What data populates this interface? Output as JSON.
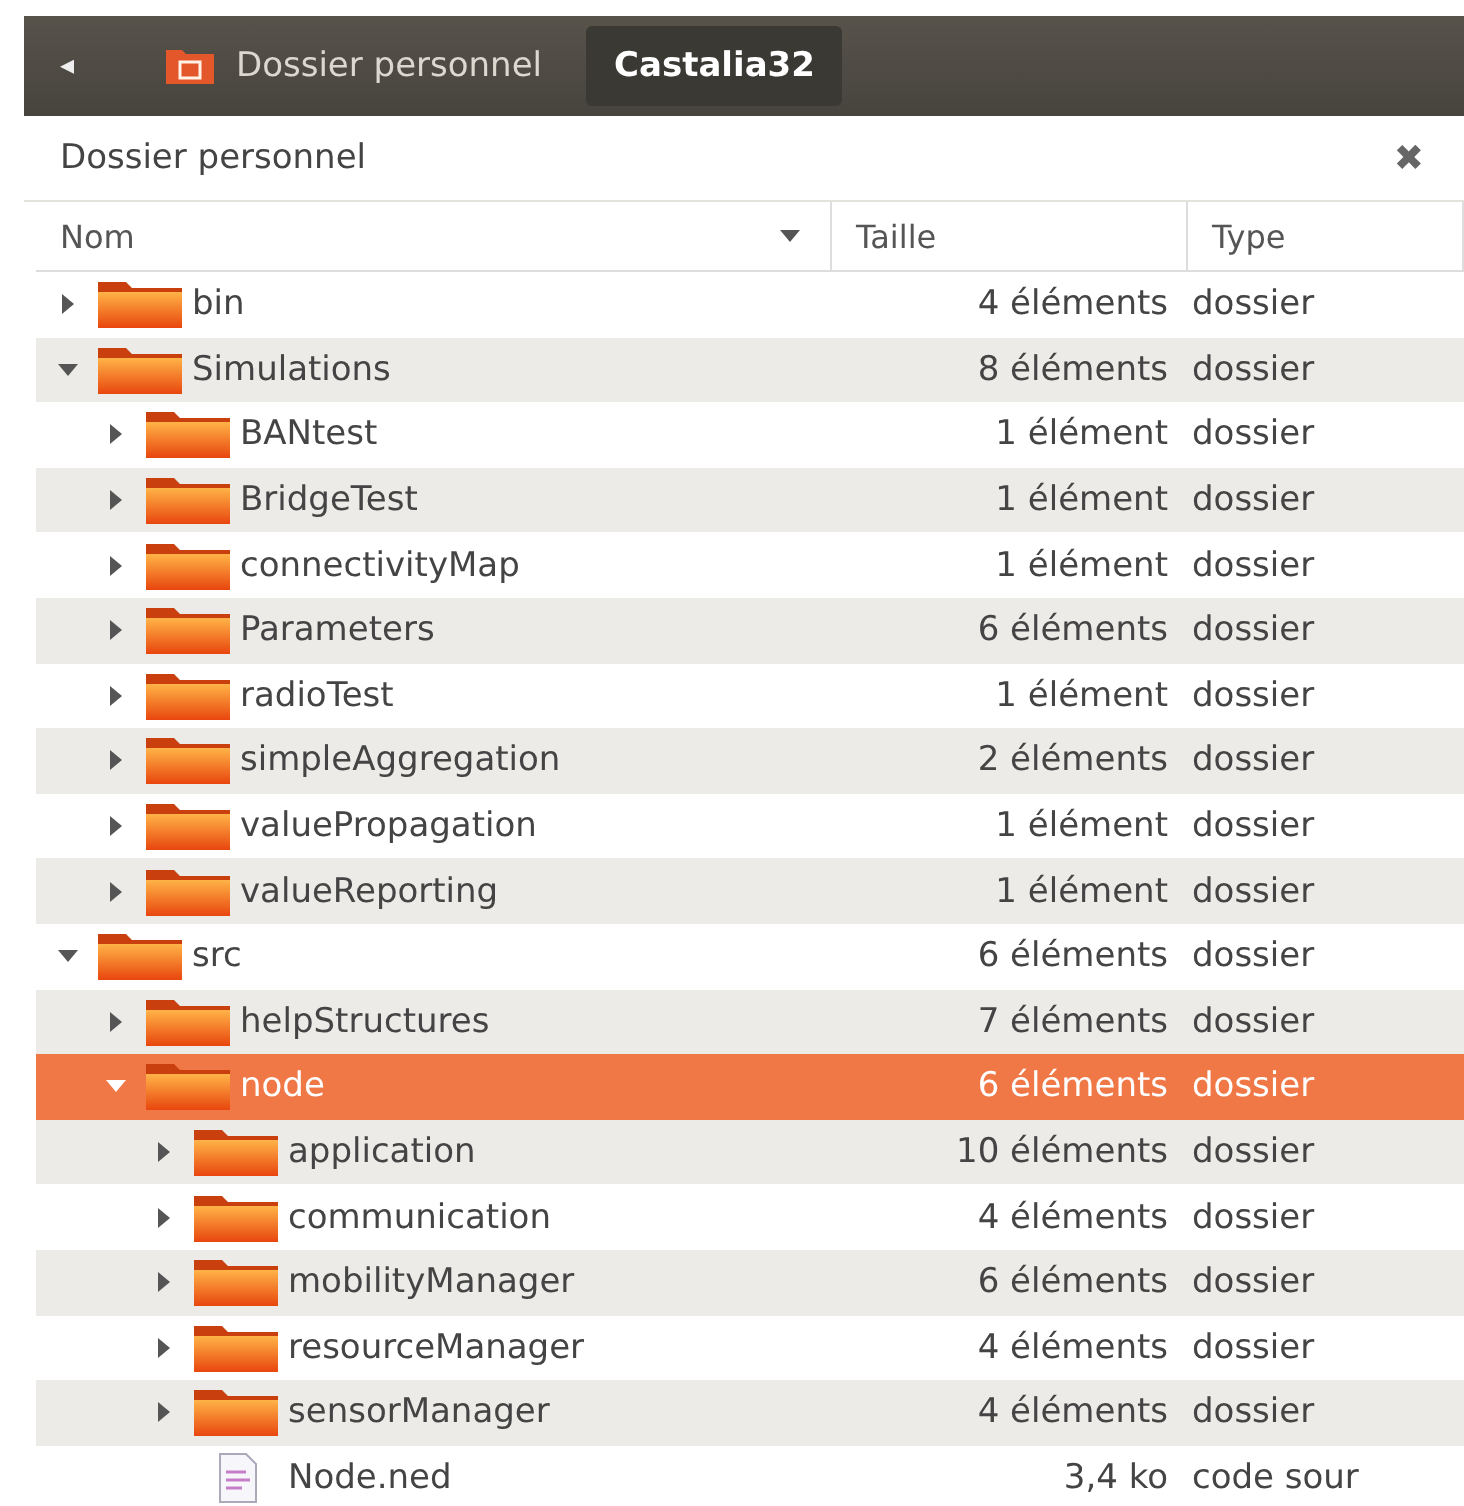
{
  "path_bar": {
    "back": "◂",
    "crumbs": [
      {
        "label": "Dossier personnel",
        "selected": false,
        "kind": "home"
      },
      {
        "label": "Castalia32",
        "selected": true,
        "kind": "plain"
      }
    ]
  },
  "pane": {
    "title": "Dossier personnel",
    "close": "✖"
  },
  "table": {
    "columns": [
      {
        "label": "Nom",
        "sorted": true
      },
      {
        "label": "Taille",
        "sorted": false
      },
      {
        "label": "Type",
        "sorted": false
      }
    ],
    "rows": [
      {
        "kind": "folder",
        "name": "bin",
        "size": "4 éléments",
        "type": "dossier",
        "expanded": false,
        "selected": false
      },
      {
        "kind": "folder",
        "name": "Simulations",
        "size": "8 éléments",
        "type": "dossier",
        "expanded": true,
        "selected": false,
        "children": [
          {
            "kind": "folder",
            "name": "BANtest",
            "size": "1 élément",
            "type": "dossier",
            "expanded": false,
            "selected": false
          },
          {
            "kind": "folder",
            "name": "BridgeTest",
            "size": "1 élément",
            "type": "dossier",
            "expanded": false,
            "selected": false
          },
          {
            "kind": "folder",
            "name": "connectivityMap",
            "size": "1 élément",
            "type": "dossier",
            "expanded": false,
            "selected": false
          },
          {
            "kind": "folder",
            "name": "Parameters",
            "size": "6 éléments",
            "type": "dossier",
            "expanded": false,
            "selected": false
          },
          {
            "kind": "folder",
            "name": "radioTest",
            "size": "1 élément",
            "type": "dossier",
            "expanded": false,
            "selected": false
          },
          {
            "kind": "folder",
            "name": "simpleAggregation",
            "size": "2 éléments",
            "type": "dossier",
            "expanded": false,
            "selected": false
          },
          {
            "kind": "folder",
            "name": "valuePropagation",
            "size": "1 élément",
            "type": "dossier",
            "expanded": false,
            "selected": false
          },
          {
            "kind": "folder",
            "name": "valueReporting",
            "size": "1 élément",
            "type": "dossier",
            "expanded": false,
            "selected": false
          }
        ]
      },
      {
        "kind": "folder",
        "name": "src",
        "size": "6 éléments",
        "type": "dossier",
        "expanded": true,
        "selected": false,
        "children": [
          {
            "kind": "folder",
            "name": "helpStructures",
            "size": "7 éléments",
            "type": "dossier",
            "expanded": false,
            "selected": false
          },
          {
            "kind": "folder",
            "name": "node",
            "size": "6 éléments",
            "type": "dossier",
            "expanded": true,
            "selected": true,
            "children": [
              {
                "kind": "folder",
                "name": "application",
                "size": "10 éléments",
                "type": "dossier",
                "expanded": false,
                "selected": false
              },
              {
                "kind": "folder",
                "name": "communication",
                "size": "4 éléments",
                "type": "dossier",
                "expanded": false,
                "selected": false
              },
              {
                "kind": "folder",
                "name": "mobilityManager",
                "size": "6 éléments",
                "type": "dossier",
                "expanded": false,
                "selected": false
              },
              {
                "kind": "folder",
                "name": "resourceManager",
                "size": "4 éléments",
                "type": "dossier",
                "expanded": false,
                "selected": false
              },
              {
                "kind": "folder",
                "name": "sensorManager",
                "size": "4 éléments",
                "type": "dossier",
                "expanded": false,
                "selected": false
              },
              {
                "kind": "file",
                "name": "Node.ned",
                "size": "3,4 ko",
                "type": "code sour",
                "selected": false
              }
            ]
          }
        ]
      }
    ]
  }
}
